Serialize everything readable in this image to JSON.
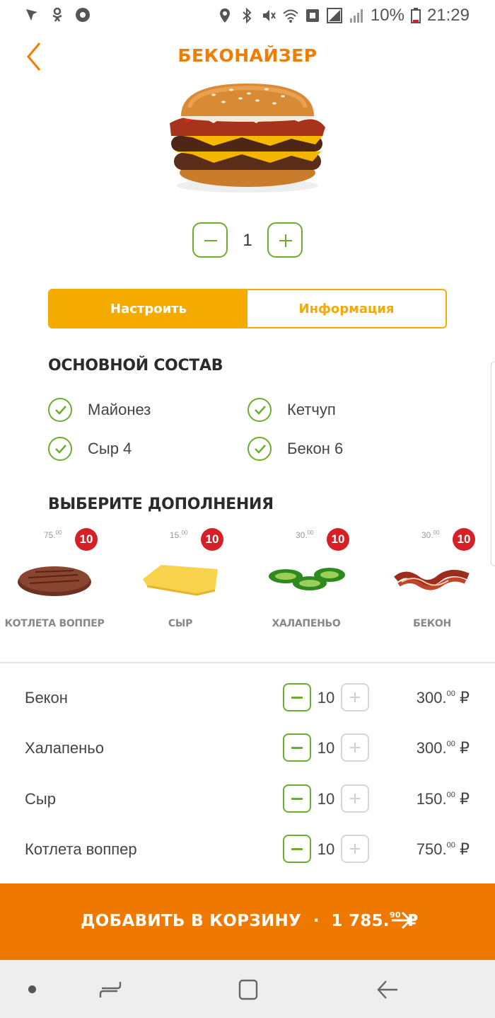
{
  "status_bar": {
    "battery": "10%",
    "time": "21:29"
  },
  "header": {
    "title": "БЕКОНАЙЗЕР"
  },
  "quantity": {
    "value": "1"
  },
  "tabs": [
    {
      "label": "Настроить",
      "active": true
    },
    {
      "label": "Информация",
      "active": false
    }
  ],
  "main_composition": {
    "heading": "ОСНОВНОЙ СОСТАВ",
    "items": [
      {
        "label": "Майонез",
        "checked": true
      },
      {
        "label": "Кетчуп",
        "checked": true
      },
      {
        "label": "Сыр 4",
        "checked": true
      },
      {
        "label": "Бекон 6",
        "checked": true
      }
    ]
  },
  "extras": {
    "heading": "ВЫБЕРИТЕ ДОПОЛНЕНИЯ",
    "items": [
      {
        "name": "КОТЛЕТА ВОППЕР",
        "price": "75.",
        "price_cents": "00",
        "count": "10"
      },
      {
        "name": "СЫР",
        "price": "15.",
        "price_cents": "00",
        "count": "10"
      },
      {
        "name": "ХАЛАПЕНЬО",
        "price": "30.",
        "price_cents": "00",
        "count": "10"
      },
      {
        "name": "БЕКОН",
        "price": "30.",
        "price_cents": "00",
        "count": "10"
      }
    ]
  },
  "selected": [
    {
      "label": "Бекон",
      "qty": "10",
      "price": "300.",
      "cents": "00",
      "currency": "₽"
    },
    {
      "label": "Халапеньо",
      "qty": "10",
      "price": "300.",
      "cents": "00",
      "currency": "₽"
    },
    {
      "label": "Сыр",
      "qty": "10",
      "price": "150.",
      "cents": "00",
      "currency": "₽"
    },
    {
      "label": "Котлета воппер",
      "qty": "10",
      "price": "750.",
      "cents": "00",
      "currency": "₽"
    }
  ],
  "cta": {
    "label": "ДОБАВИТЬ В КОРЗИНУ",
    "separator": "·",
    "total": "1 785.",
    "total_cents": "90",
    "currency": "₽"
  },
  "colors": {
    "brand_orange": "#ef7900",
    "tab_yellow": "#f5aa00",
    "check_green": "#6aad2f",
    "badge_red": "#d42027"
  }
}
